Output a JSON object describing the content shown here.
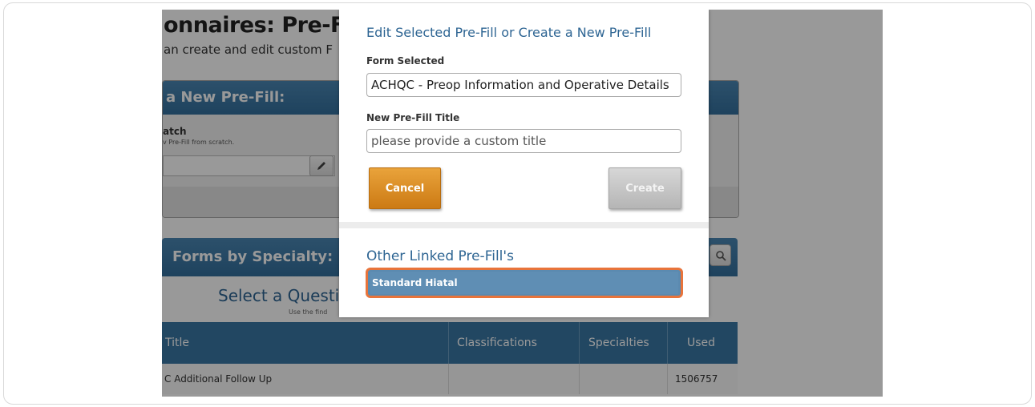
{
  "page": {
    "title": "onnaires: Pre-Fil",
    "subtitle": "an create and edit custom F",
    "new_prefill_panel": {
      "header": "a New Pre-Fill:",
      "scratch_title": "atch",
      "scratch_desc": "v Pre-Fill from scratch."
    },
    "forms_by_specialty": {
      "header": "Forms by Specialty:",
      "select_prompt": "Select a Questi",
      "find_hint": "Use the find"
    },
    "table": {
      "columns": [
        "Title",
        "Classifications",
        "Specialties",
        "Used"
      ],
      "rows": [
        {
          "title": "C Additional Follow Up",
          "classifications": "",
          "specialties": "",
          "used": "1506757"
        }
      ]
    }
  },
  "modal": {
    "title": "Edit Selected Pre-Fill or Create a New Pre-Fill",
    "form_selected_label": "Form Selected",
    "form_selected_value": "ACHQC - Preop Information and Operative Details",
    "new_title_label": "New Pre-Fill Title",
    "new_title_placeholder": "please provide a custom title",
    "cancel_label": "Cancel",
    "create_label": "Create",
    "linked_title": "Other Linked Pre-Fill's",
    "linked_items": [
      "Standard Hiatal"
    ]
  },
  "colors": {
    "accent_blue": "#2e6593",
    "header_blue": "#3a77a4",
    "cancel_orange": "#d98a22",
    "highlight_orange": "#e8743b",
    "linked_item_bg": "#5b8ab0"
  },
  "icons": [
    "pencil-icon",
    "search-icon"
  ]
}
